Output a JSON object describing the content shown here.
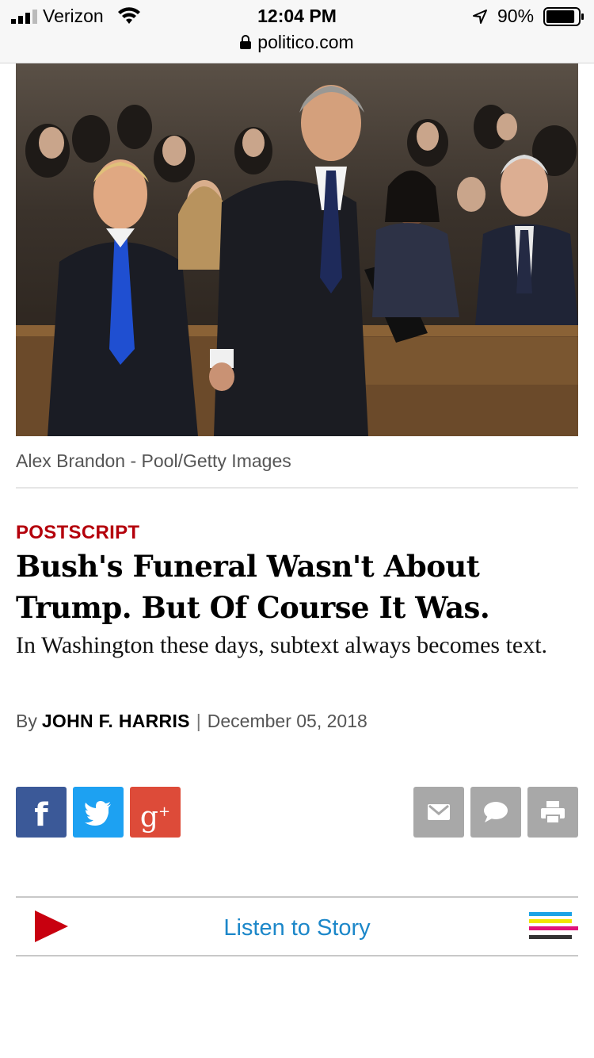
{
  "status_bar": {
    "carrier": "Verizon",
    "time": "12:04 PM",
    "battery_percent": "90%",
    "battery_level": 0.9
  },
  "url_bar": {
    "domain": "politico.com"
  },
  "photo": {
    "description_icon": "photo-image",
    "credit": "Alex Brandon - Pool/Getty Images"
  },
  "article": {
    "kicker": "POSTSCRIPT",
    "headline": "Bush's Funeral Wasn't About Trump. But Of Course It Was.",
    "dek": "In Washington these days, subtext always becomes text.",
    "byline_prefix": "By",
    "author": "JOHN F. HARRIS",
    "separator": "|",
    "date": "December 05, 2018"
  },
  "share": {
    "facebook_glyph": "f",
    "googleplus_glyph": "g",
    "googleplus_sup": "+",
    "icons": [
      "facebook-icon",
      "twitter-icon",
      "google-plus-icon",
      "email-icon",
      "comment-icon",
      "print-icon"
    ]
  },
  "listen": {
    "label": "Listen to Story",
    "play_color": "#c8000f",
    "accent_color": "#1c87c9"
  },
  "colors": {
    "kicker": "#b4000b",
    "facebook": "#3b5998",
    "twitter": "#1da1f2",
    "googleplus": "#dd4b39",
    "utility_buttons": "#a8a8a8"
  }
}
